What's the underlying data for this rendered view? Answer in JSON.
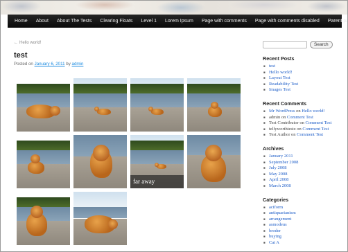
{
  "nav": {
    "items": [
      "Home",
      "About",
      "About The Tests",
      "Clearing Floats",
      "Level 1",
      "Lorem Ipsum",
      "Page with comments",
      "Page with comments disabled",
      "Parent page"
    ]
  },
  "post": {
    "back_link": "Hello world!",
    "back_arrow": "←",
    "title": "test",
    "meta_prefix": "Posted on",
    "date": "January 6, 2011",
    "by": "by",
    "author": "admin"
  },
  "gallery": {
    "caption": "far away",
    "count": 10
  },
  "sidebar": {
    "search_button": "Search",
    "recent_posts": {
      "title": "Recent Posts",
      "items": [
        "test",
        "Hello world!",
        "Layout Test",
        "Readability Test",
        "Images Test"
      ]
    },
    "recent_comments": {
      "title": "Recent Comments",
      "items": [
        {
          "who": "Mr WordPress",
          "on": "on",
          "post": "Hello world!"
        },
        {
          "who": "admin",
          "on": "on",
          "post": "Comment Test"
        },
        {
          "who": "Test Contributor",
          "on": "on",
          "post": "Comment Test"
        },
        {
          "who": "tellyworthtestz",
          "on": "on",
          "post": "Comment Test"
        },
        {
          "who": "Test Author",
          "on": "on",
          "post": "Comment Test"
        }
      ]
    },
    "archives": {
      "title": "Archives",
      "items": [
        "January 2011",
        "September 2008",
        "July 2008",
        "May 2008",
        "April 2008",
        "March 2008"
      ]
    },
    "categories": {
      "title": "Categories",
      "items": [
        "aciform",
        "antiquarianism",
        "arrangement",
        "asmodeus",
        "broder",
        "buying",
        "Cat A"
      ]
    }
  }
}
